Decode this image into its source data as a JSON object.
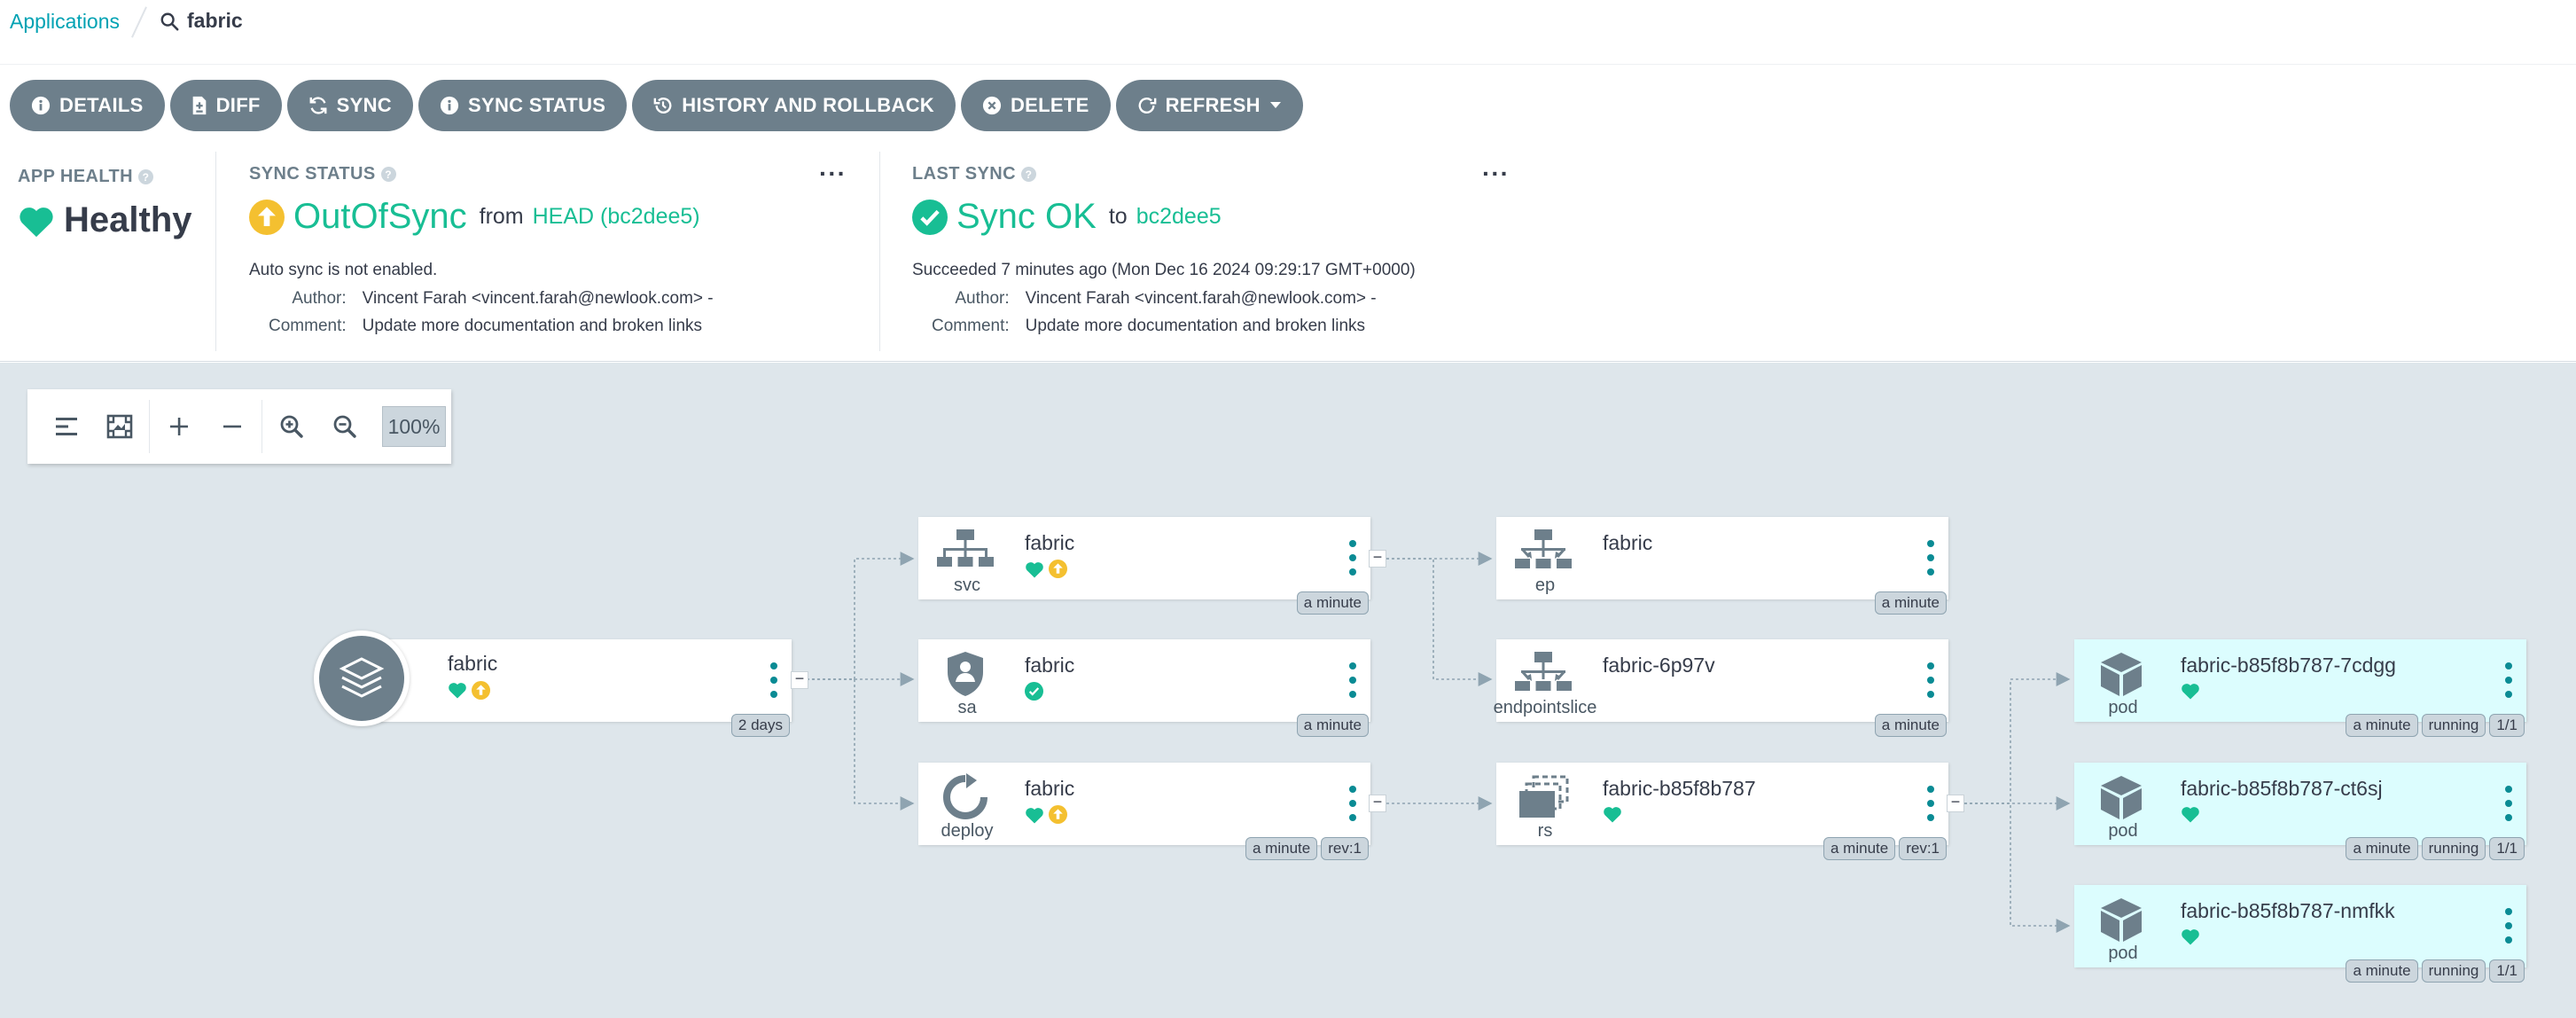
{
  "breadcrumb": {
    "link": "Applications",
    "current": "fabric"
  },
  "actions": {
    "details": "DETAILS",
    "diff": "DIFF",
    "sync": "SYNC",
    "sync_status": "SYNC STATUS",
    "history": "HISTORY AND ROLLBACK",
    "delete": "DELETE",
    "refresh": "REFRESH"
  },
  "app_health": {
    "label": "APP HEALTH",
    "value": "Healthy"
  },
  "sync_status": {
    "label": "SYNC STATUS",
    "value": "OutOfSync",
    "from": "from",
    "revision": "HEAD (bc2dee5)",
    "auto_sync": "Auto sync is not enabled.",
    "author_label": "Author:",
    "author": "Vincent Farah <vincent.farah@newlook.com> -",
    "comment_label": "Comment:",
    "comment": "Update more documentation and broken links"
  },
  "last_sync": {
    "label": "LAST SYNC",
    "value": "Sync OK",
    "to": "to",
    "revision": "bc2dee5",
    "succeeded": "Succeeded 7 minutes ago (Mon Dec 16 2024 09:29:17 GMT+0000)",
    "author_label": "Author:",
    "author": "Vincent Farah <vincent.farah@newlook.com> -",
    "comment_label": "Comment:",
    "comment": "Update more documentation and broken links"
  },
  "toolbar": {
    "zoom": "100%"
  },
  "colors": {
    "accent": "#00a2b3",
    "healthy": "#18be94",
    "outofsync": "#f4c030",
    "button": "#6d7f8b"
  },
  "graph": {
    "app": {
      "name": "fabric",
      "age": "2 days"
    },
    "nodes": {
      "svc": {
        "name": "fabric",
        "kind": "svc",
        "age": "a minute"
      },
      "sa": {
        "name": "fabric",
        "kind": "sa",
        "age": "a minute"
      },
      "deploy": {
        "name": "fabric",
        "kind": "deploy",
        "age": "a minute",
        "rev": "rev:1"
      },
      "ep": {
        "name": "fabric",
        "kind": "ep",
        "age": "a minute"
      },
      "eps": {
        "name": "fabric-6p97v",
        "kind": "endpointslice",
        "age": "a minute"
      },
      "rs": {
        "name": "fabric-b85f8b787",
        "kind": "rs",
        "age": "a minute",
        "rev": "rev:1"
      },
      "pod1": {
        "name": "fabric-b85f8b787-7cdgg",
        "kind": "pod",
        "age": "a minute",
        "status": "running",
        "ready": "1/1"
      },
      "pod2": {
        "name": "fabric-b85f8b787-ct6sj",
        "kind": "pod",
        "age": "a minute",
        "status": "running",
        "ready": "1/1"
      },
      "pod3": {
        "name": "fabric-b85f8b787-nmfkk",
        "kind": "pod",
        "age": "a minute",
        "status": "running",
        "ready": "1/1"
      }
    }
  }
}
